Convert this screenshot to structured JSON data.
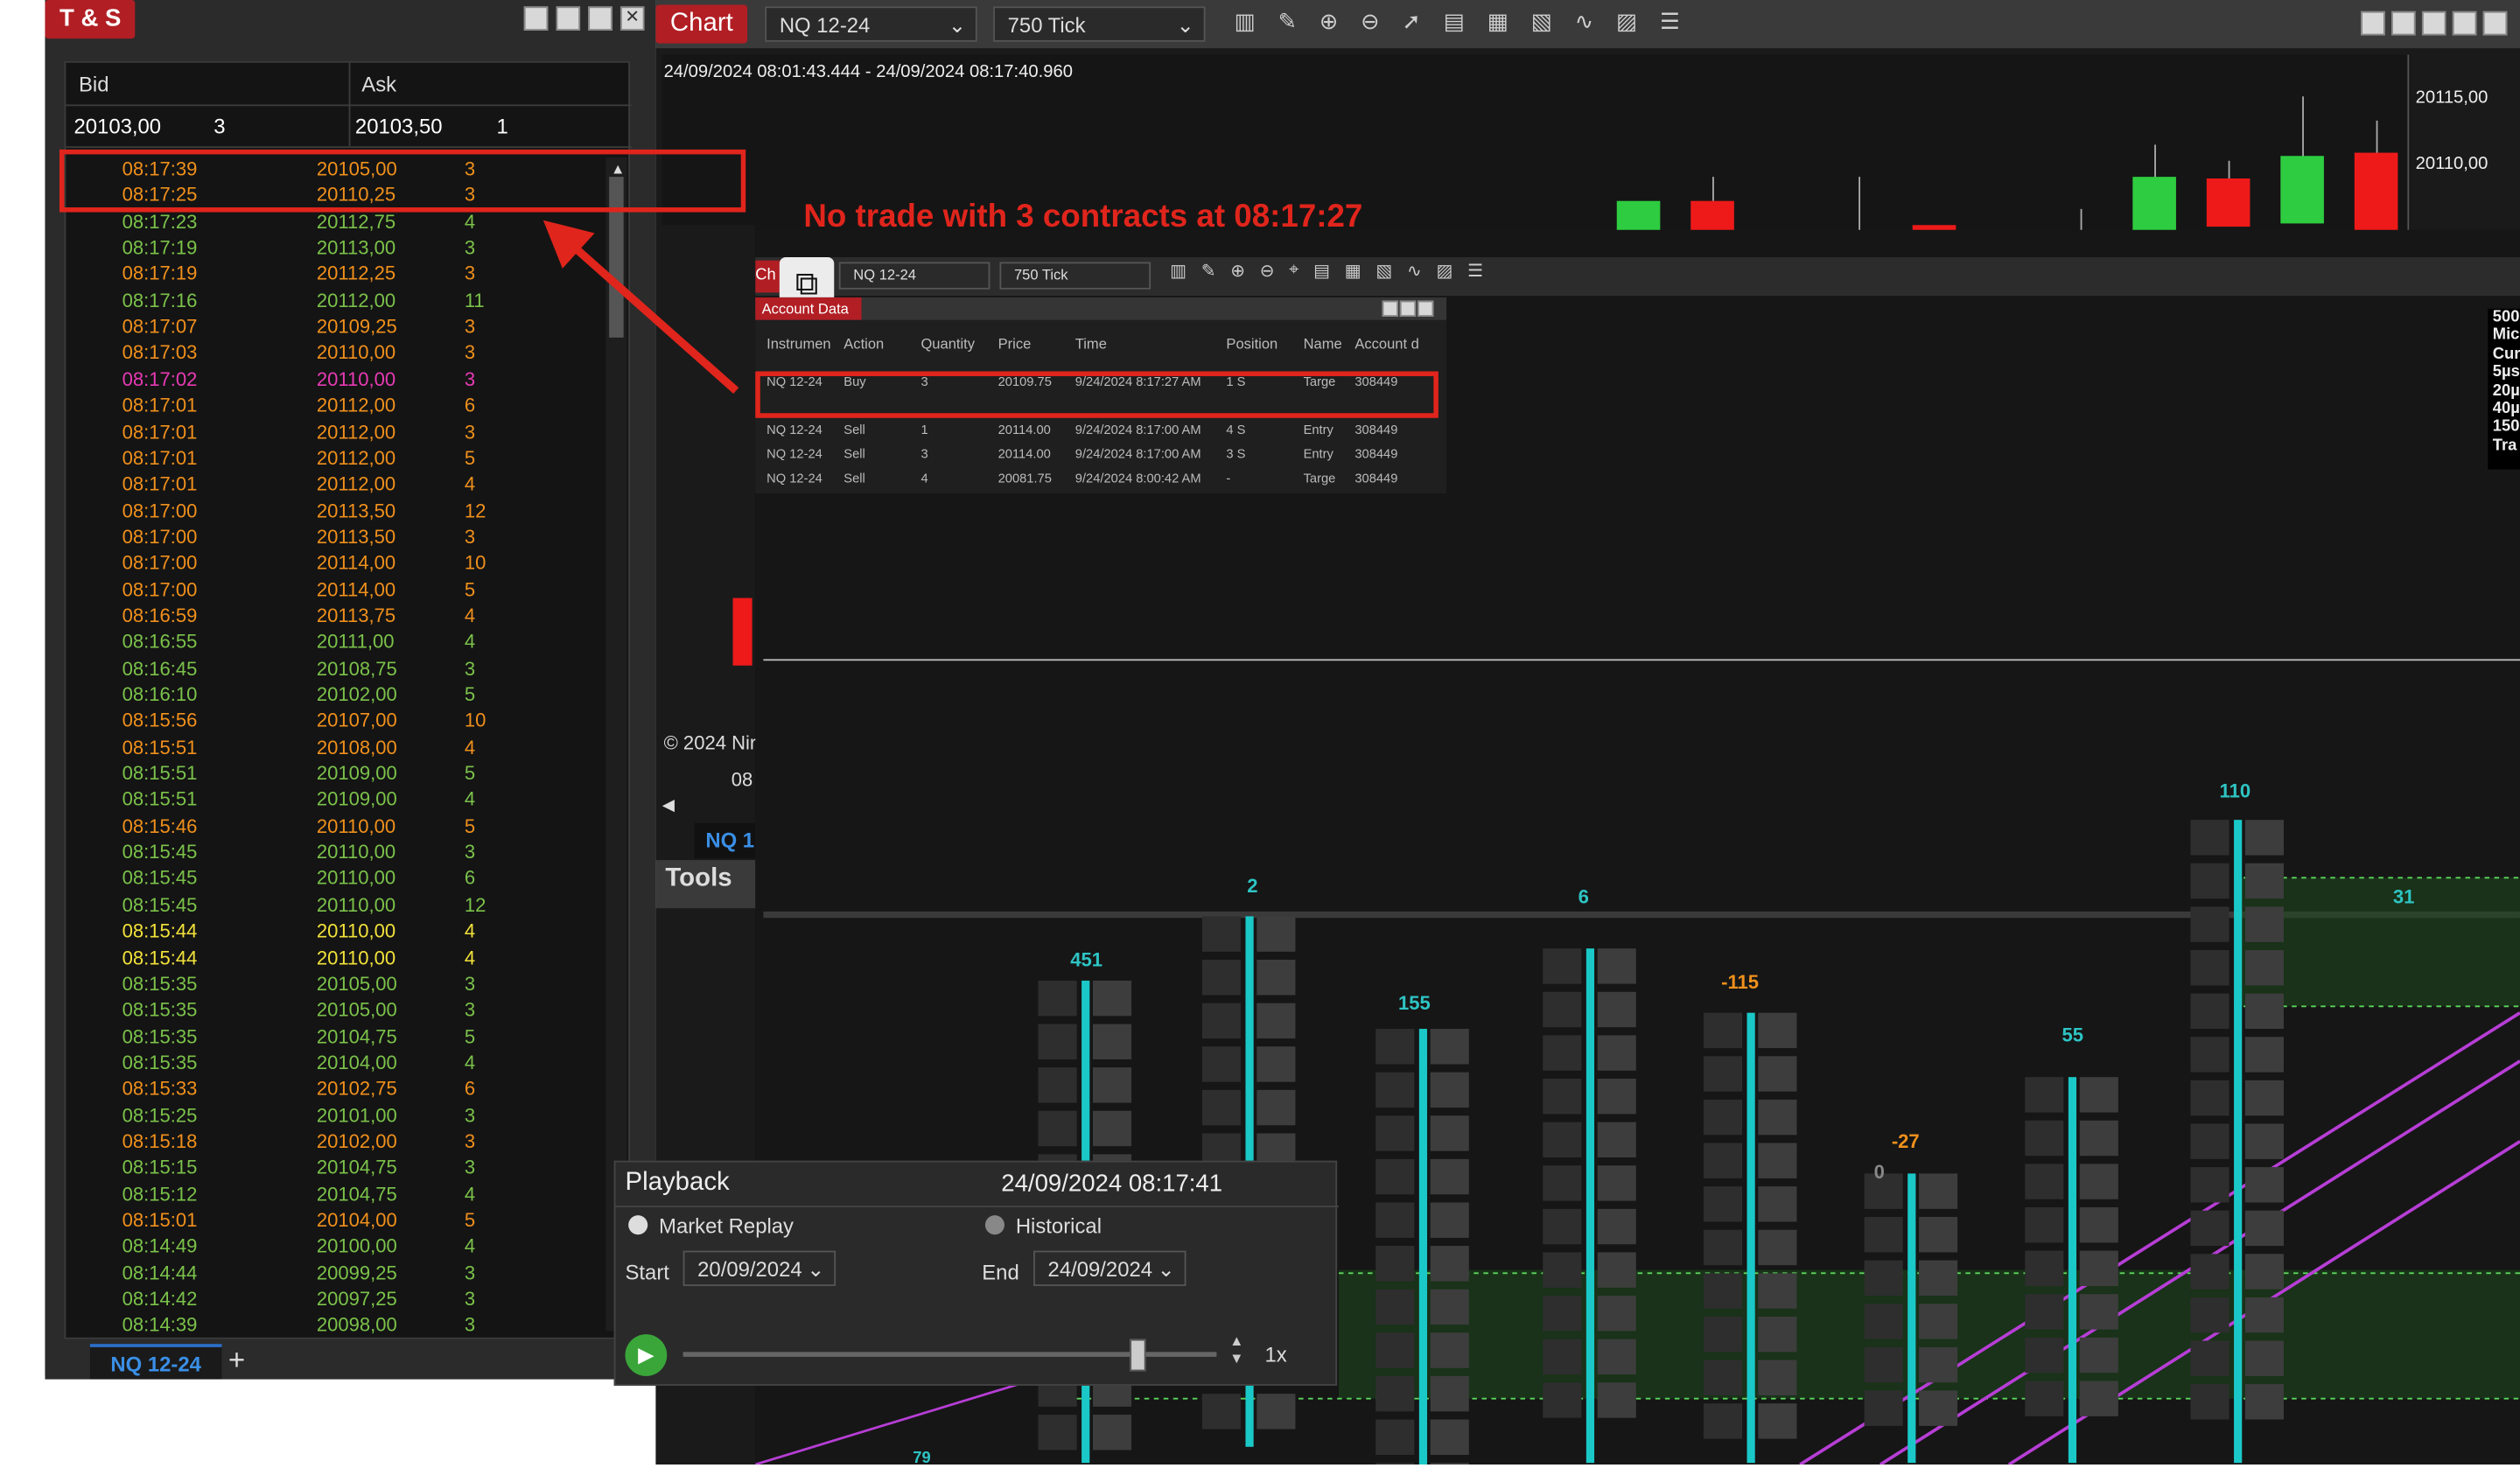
{
  "ts": {
    "title": "T & S",
    "bid_label": "Bid",
    "ask_label": "Ask",
    "bid_price": "20103,00",
    "bid_size": "3",
    "ask_price": "20103,50",
    "ask_size": "1",
    "rows": [
      {
        "time": "08:17:39",
        "price": "20105,00",
        "size": "3",
        "color": "#f0901c"
      },
      {
        "time": "08:17:25",
        "price": "20110,25",
        "size": "3",
        "color": "#f0901c"
      },
      {
        "time": "08:17:23",
        "price": "20112,75",
        "size": "4",
        "color": "#7bc24a"
      },
      {
        "time": "08:17:19",
        "price": "20113,00",
        "size": "3",
        "color": "#7bc24a"
      },
      {
        "time": "08:17:19",
        "price": "20112,25",
        "size": "3",
        "color": "#f0901c"
      },
      {
        "time": "08:17:16",
        "price": "20112,00",
        "size": "11",
        "color": "#7bc24a"
      },
      {
        "time": "08:17:07",
        "price": "20109,25",
        "size": "3",
        "color": "#f0901c"
      },
      {
        "time": "08:17:03",
        "price": "20110,00",
        "size": "3",
        "color": "#f0901c"
      },
      {
        "time": "08:17:02",
        "price": "20110,00",
        "size": "3",
        "color": "#e83ab4"
      },
      {
        "time": "08:17:01",
        "price": "20112,00",
        "size": "6",
        "color": "#f0901c"
      },
      {
        "time": "08:17:01",
        "price": "20112,00",
        "size": "3",
        "color": "#f0901c"
      },
      {
        "time": "08:17:01",
        "price": "20112,00",
        "size": "5",
        "color": "#f0901c"
      },
      {
        "time": "08:17:01",
        "price": "20112,00",
        "size": "4",
        "color": "#f0901c"
      },
      {
        "time": "08:17:00",
        "price": "20113,50",
        "size": "12",
        "color": "#f0901c"
      },
      {
        "time": "08:17:00",
        "price": "20113,50",
        "size": "3",
        "color": "#f0901c"
      },
      {
        "time": "08:17:00",
        "price": "20114,00",
        "size": "10",
        "color": "#f0901c"
      },
      {
        "time": "08:17:00",
        "price": "20114,00",
        "size": "5",
        "color": "#f0901c"
      },
      {
        "time": "08:16:59",
        "price": "20113,75",
        "size": "4",
        "color": "#f0901c"
      },
      {
        "time": "08:16:55",
        "price": "20111,00",
        "size": "4",
        "color": "#7bc24a"
      },
      {
        "time": "08:16:45",
        "price": "20108,75",
        "size": "3",
        "color": "#7bc24a"
      },
      {
        "time": "08:16:10",
        "price": "20102,00",
        "size": "5",
        "color": "#7bc24a"
      },
      {
        "time": "08:15:56",
        "price": "20107,00",
        "size": "10",
        "color": "#f0901c"
      },
      {
        "time": "08:15:51",
        "price": "20108,00",
        "size": "4",
        "color": "#f0901c"
      },
      {
        "time": "08:15:51",
        "price": "20109,00",
        "size": "5",
        "color": "#7bc24a"
      },
      {
        "time": "08:15:51",
        "price": "20109,00",
        "size": "4",
        "color": "#7bc24a"
      },
      {
        "time": "08:15:46",
        "price": "20110,00",
        "size": "5",
        "color": "#f0901c"
      },
      {
        "time": "08:15:45",
        "price": "20110,00",
        "size": "3",
        "color": "#7bc24a"
      },
      {
        "time": "08:15:45",
        "price": "20110,00",
        "size": "6",
        "color": "#7bc24a"
      },
      {
        "time": "08:15:45",
        "price": "20110,00",
        "size": "12",
        "color": "#7bc24a"
      },
      {
        "time": "08:15:44",
        "price": "20110,00",
        "size": "4",
        "color": "#f2e23a"
      },
      {
        "time": "08:15:44",
        "price": "20110,00",
        "size": "4",
        "color": "#f2e23a"
      },
      {
        "time": "08:15:35",
        "price": "20105,00",
        "size": "3",
        "color": "#7bc24a"
      },
      {
        "time": "08:15:35",
        "price": "20105,00",
        "size": "3",
        "color": "#7bc24a"
      },
      {
        "time": "08:15:35",
        "price": "20104,75",
        "size": "5",
        "color": "#7bc24a"
      },
      {
        "time": "08:15:35",
        "price": "20104,00",
        "size": "4",
        "color": "#7bc24a"
      },
      {
        "time": "08:15:33",
        "price": "20102,75",
        "size": "6",
        "color": "#f0901c"
      },
      {
        "time": "08:15:25",
        "price": "20101,00",
        "size": "3",
        "color": "#7bc24a"
      },
      {
        "time": "08:15:18",
        "price": "20102,00",
        "size": "3",
        "color": "#f0901c"
      },
      {
        "time": "08:15:15",
        "price": "20104,75",
        "size": "3",
        "color": "#7bc24a"
      },
      {
        "time": "08:15:12",
        "price": "20104,75",
        "size": "4",
        "color": "#7bc24a"
      },
      {
        "time": "08:15:01",
        "price": "20104,00",
        "size": "5",
        "color": "#f0901c"
      },
      {
        "time": "08:14:49",
        "price": "20100,00",
        "size": "4",
        "color": "#7bc24a"
      },
      {
        "time": "08:14:44",
        "price": "20099,25",
        "size": "3",
        "color": "#7bc24a"
      },
      {
        "time": "08:14:42",
        "price": "20097,25",
        "size": "3",
        "color": "#7bc24a"
      },
      {
        "time": "08:14:39",
        "price": "20098,00",
        "size": "3",
        "color": "#7bc24a"
      }
    ],
    "tab": "NQ 12-24",
    "add_tab": "+"
  },
  "chart": {
    "tab": "Chart",
    "instrument": "NQ 12-24",
    "period": "750 Tick",
    "range": "24/09/2024 08:01:43.444 - 24/09/2024 08:17:40.960",
    "price1": "20115,00",
    "price2": "20110,00",
    "copyright": "© 2024 Nir",
    "tab_nq": "NQ 1",
    "tools": "Tools",
    "x08": "08"
  },
  "annotation": "No trade with 3 contracts at 08:17:27",
  "inner": {
    "instrument": "NQ 12-24",
    "period": "750 Tick",
    "tab": "Ch",
    "panel": "Account Data",
    "headers": [
      "Instrumen",
      "Action",
      "Quantity",
      "Price",
      "Time",
      "Position",
      "Name",
      "Account d"
    ],
    "rows": [
      [
        "NQ 12-24",
        "Buy",
        "3",
        "20109.75",
        "9/24/2024 8:17:27 AM",
        "1 S",
        "Targe",
        "308449"
      ],
      [
        "NQ 12-24",
        "Sell",
        "1",
        "20114.00",
        "9/24/2024 8:17:00 AM",
        "4 S",
        "Entry",
        "308449"
      ],
      [
        "NQ 12-24",
        "Sell",
        "3",
        "20114.00",
        "9/24/2024 8:17:00 AM",
        "3 S",
        "Entry",
        "308449"
      ],
      [
        "NQ 12-24",
        "Sell",
        "4",
        "20081.75",
        "9/24/2024 8:00:42 AM",
        "-",
        "Targe",
        "308449"
      ]
    ],
    "side": [
      "500",
      "Mic",
      "Cur",
      "5µs",
      "20µ",
      "40µ",
      "150",
      "Tra"
    ]
  },
  "playback": {
    "title": "Playback",
    "datetime": "24/09/2024 08:17:41",
    "market_replay": "Market Replay",
    "historical": "Historical",
    "start_label": "Start",
    "start": "20/09/2024",
    "end_label": "End",
    "end": "24/09/2024",
    "speed": "1x"
  },
  "footprint": {
    "deltas": [
      "451",
      "2",
      "155",
      "6",
      "-115",
      "55",
      "-27",
      "0",
      "110",
      "31",
      "79"
    ]
  }
}
